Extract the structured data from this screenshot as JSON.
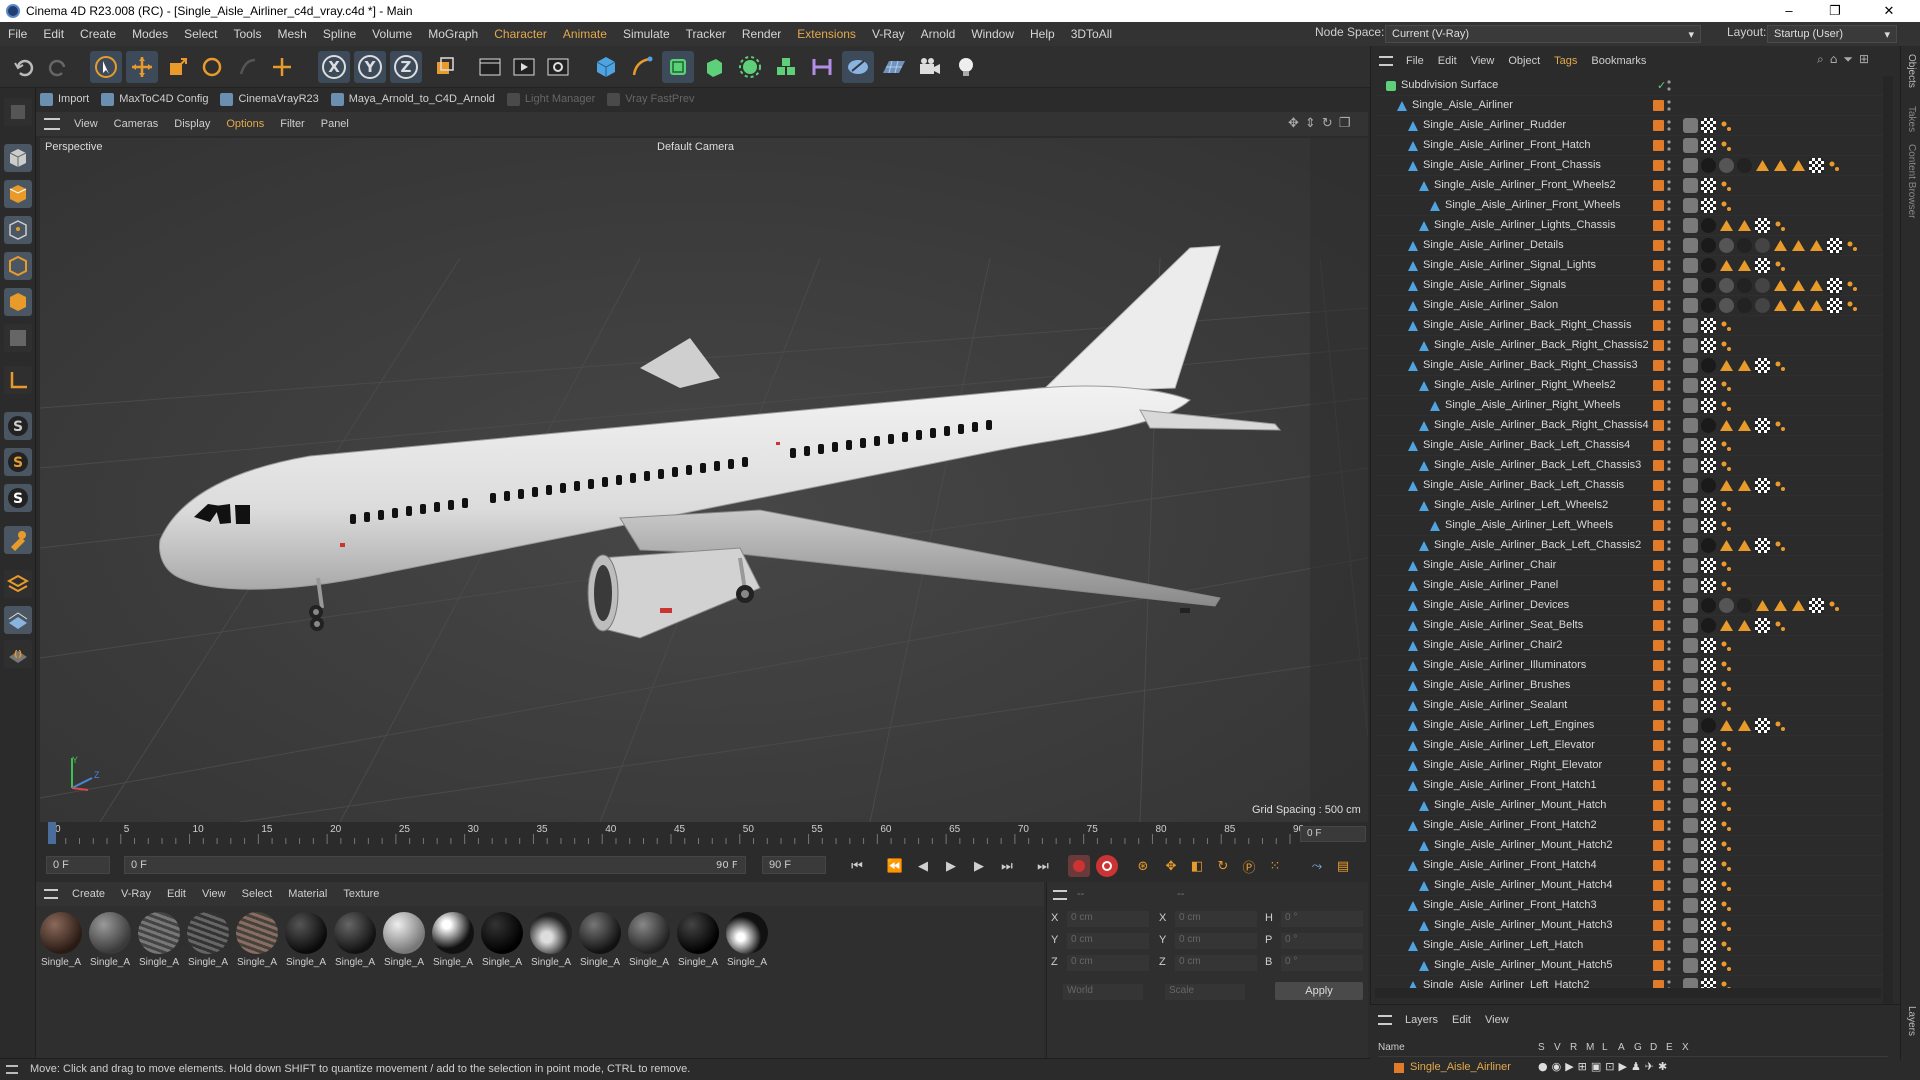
{
  "window": {
    "title": "Cinema 4D R23.008 (RC) - [Single_Aisle_Airliner_c4d_vray.c4d *] - Main",
    "controls": [
      "–",
      "❐",
      "✕"
    ]
  },
  "menubar": [
    "File",
    "Edit",
    "Create",
    "Modes",
    "Select",
    "Tools",
    "Mesh",
    "Spline",
    "Volume",
    "MoGraph",
    "Character",
    "Animate",
    "Simulate",
    "Tracker",
    "Render",
    "Extensions",
    "V-Ray",
    "Arnold",
    "Window",
    "Help",
    "3DToAll"
  ],
  "menubar_highlighted": [
    "Character",
    "Animate",
    "Extensions"
  ],
  "node_space": {
    "label": "Node Space:",
    "value": "Current (V-Ray)"
  },
  "layout": {
    "label": "Layout:",
    "value": "Startup (User)"
  },
  "plugins": [
    {
      "label": "Import",
      "dim": false
    },
    {
      "label": "MaxToC4D Config",
      "dim": false
    },
    {
      "label": "CinemaVrayR23",
      "dim": false
    },
    {
      "label": "Maya_Arnold_to_C4D_Arnold",
      "dim": false
    },
    {
      "label": "Light Manager",
      "dim": true
    },
    {
      "label": "Vray FastPrev",
      "dim": true
    }
  ],
  "viewport_menu": [
    "View",
    "Cameras",
    "Display",
    "Options",
    "Filter",
    "Panel"
  ],
  "viewport_menu_highlight": "Options",
  "viewport": {
    "mode": "Perspective",
    "camera": "Default Camera",
    "grid_spacing": "Grid Spacing : 500 cm",
    "axis_y": "Y",
    "axis_z": "Z"
  },
  "timeline": {
    "ticks": [
      "0",
      "5",
      "10",
      "15",
      "20",
      "25",
      "30",
      "35",
      "40",
      "45",
      "50",
      "55",
      "60",
      "65",
      "70",
      "75",
      "80",
      "85",
      "90"
    ],
    "frame_end_field": "0 F"
  },
  "time_controls": {
    "start": "0 F",
    "current": "0 F",
    "range_end": "90 F",
    "end": "90 F"
  },
  "material_menu": [
    "Create",
    "V-Ray",
    "Edit",
    "View",
    "Select",
    "Material",
    "Texture"
  ],
  "materials": [
    "Single_A",
    "Single_A",
    "Single_A",
    "Single_A",
    "Single_A",
    "Single_A",
    "Single_A",
    "Single_A",
    "Single_A",
    "Single_A",
    "Single_A",
    "Single_A",
    "Single_A",
    "Single_A",
    "Single_A"
  ],
  "coordinates": {
    "header": "--",
    "header2": "--",
    "rows": [
      {
        "l1": "X",
        "v1": "0 cm",
        "l2": "X",
        "v2": "0 cm",
        "l3": "H",
        "v3": "0 °"
      },
      {
        "l1": "Y",
        "v1": "0 cm",
        "l2": "Y",
        "v2": "0 cm",
        "l3": "P",
        "v3": "0 °"
      },
      {
        "l1": "Z",
        "v1": "0 cm",
        "l2": "Z",
        "v2": "0 cm",
        "l3": "B",
        "v3": "0 °"
      }
    ],
    "world": "World",
    "scale": "Scale",
    "apply": "Apply"
  },
  "status": "Move: Click and drag to move elements. Hold down SHIFT to quantize movement / add to the selection in point mode, CTRL to remove.",
  "object_menu": [
    "File",
    "Edit",
    "View",
    "Object",
    "Tags",
    "Bookmarks"
  ],
  "object_menu_highlight": "Tags",
  "objects": [
    {
      "name": "Subdivision Surface",
      "indent": 0,
      "tags": 0
    },
    {
      "name": "Single_Aisle_Airliner",
      "indent": 1,
      "tags": 0
    },
    {
      "name": "Single_Aisle_Airliner_Rudder",
      "indent": 2,
      "tags": 3
    },
    {
      "name": "Single_Aisle_Airliner_Front_Hatch",
      "indent": 2,
      "tags": 3
    },
    {
      "name": "Single_Aisle_Airliner_Front_Chassis",
      "indent": 2,
      "tags": 9
    },
    {
      "name": "Single_Aisle_Airliner_Front_Wheels2",
      "indent": 3,
      "tags": 3
    },
    {
      "name": "Single_Aisle_Airliner_Front_Wheels",
      "indent": 4,
      "tags": 3
    },
    {
      "name": "Single_Aisle_Airliner_Lights_Chassis",
      "indent": 3,
      "tags": 6
    },
    {
      "name": "Single_Aisle_Airliner_Details",
      "indent": 2,
      "tags": 10
    },
    {
      "name": "Single_Aisle_Airliner_Signal_Lights",
      "indent": 2,
      "tags": 6
    },
    {
      "name": "Single_Aisle_Airliner_Signals",
      "indent": 2,
      "tags": 10
    },
    {
      "name": "Single_Aisle_Airliner_Salon",
      "indent": 2,
      "tags": 10
    },
    {
      "name": "Single_Aisle_Airliner_Back_Right_Chassis",
      "indent": 2,
      "tags": 3
    },
    {
      "name": "Single_Aisle_Airliner_Back_Right_Chassis2",
      "indent": 3,
      "tags": 3
    },
    {
      "name": "Single_Aisle_Airliner_Back_Right_Chassis3",
      "indent": 2,
      "tags": 6
    },
    {
      "name": "Single_Aisle_Airliner_Right_Wheels2",
      "indent": 3,
      "tags": 3
    },
    {
      "name": "Single_Aisle_Airliner_Right_Wheels",
      "indent": 4,
      "tags": 3
    },
    {
      "name": "Single_Aisle_Airliner_Back_Right_Chassis4",
      "indent": 3,
      "tags": 6
    },
    {
      "name": "Single_Aisle_Airliner_Back_Left_Chassis4",
      "indent": 2,
      "tags": 3
    },
    {
      "name": "Single_Aisle_Airliner_Back_Left_Chassis3",
      "indent": 3,
      "tags": 3
    },
    {
      "name": "Single_Aisle_Airliner_Back_Left_Chassis",
      "indent": 2,
      "tags": 6
    },
    {
      "name": "Single_Aisle_Airliner_Left_Wheels2",
      "indent": 3,
      "tags": 3
    },
    {
      "name": "Single_Aisle_Airliner_Left_Wheels",
      "indent": 4,
      "tags": 3
    },
    {
      "name": "Single_Aisle_Airliner_Back_Left_Chassis2",
      "indent": 3,
      "tags": 6
    },
    {
      "name": "Single_Aisle_Airliner_Chair",
      "indent": 2,
      "tags": 3
    },
    {
      "name": "Single_Aisle_Airliner_Panel",
      "indent": 2,
      "tags": 3
    },
    {
      "name": "Single_Aisle_Airliner_Devices",
      "indent": 2,
      "tags": 9
    },
    {
      "name": "Single_Aisle_Airliner_Seat_Belts",
      "indent": 2,
      "tags": 6
    },
    {
      "name": "Single_Aisle_Airliner_Chair2",
      "indent": 2,
      "tags": 3
    },
    {
      "name": "Single_Aisle_Airliner_Illuminators",
      "indent": 2,
      "tags": 3
    },
    {
      "name": "Single_Aisle_Airliner_Brushes",
      "indent": 2,
      "tags": 3
    },
    {
      "name": "Single_Aisle_Airliner_Sealant",
      "indent": 2,
      "tags": 3
    },
    {
      "name": "Single_Aisle_Airliner_Left_Engines",
      "indent": 2,
      "tags": 6
    },
    {
      "name": "Single_Aisle_Airliner_Left_Elevator",
      "indent": 2,
      "tags": 3
    },
    {
      "name": "Single_Aisle_Airliner_Right_Elevator",
      "indent": 2,
      "tags": 3
    },
    {
      "name": "Single_Aisle_Airliner_Front_Hatch1",
      "indent": 2,
      "tags": 3
    },
    {
      "name": "Single_Aisle_Airliner_Mount_Hatch",
      "indent": 3,
      "tags": 3
    },
    {
      "name": "Single_Aisle_Airliner_Front_Hatch2",
      "indent": 2,
      "tags": 3
    },
    {
      "name": "Single_Aisle_Airliner_Mount_Hatch2",
      "indent": 3,
      "tags": 3
    },
    {
      "name": "Single_Aisle_Airliner_Front_Hatch4",
      "indent": 2,
      "tags": 3
    },
    {
      "name": "Single_Aisle_Airliner_Mount_Hatch4",
      "indent": 3,
      "tags": 3
    },
    {
      "name": "Single_Aisle_Airliner_Front_Hatch3",
      "indent": 2,
      "tags": 3
    },
    {
      "name": "Single_Aisle_Airliner_Mount_Hatch3",
      "indent": 3,
      "tags": 3
    },
    {
      "name": "Single_Aisle_Airliner_Left_Hatch",
      "indent": 2,
      "tags": 3
    },
    {
      "name": "Single_Aisle_Airliner_Mount_Hatch5",
      "indent": 3,
      "tags": 3
    },
    {
      "name": "Single_Aisle_Airliner_Left_Hatch2",
      "indent": 2,
      "tags": 3
    }
  ],
  "right_tabs": [
    "Objects",
    "Takes",
    "Content Browser"
  ],
  "layers_tab": "Layers",
  "layers_menu": [
    "Layers",
    "Edit",
    "View"
  ],
  "layers_header": {
    "name": "Name",
    "cols": [
      "S",
      "V",
      "R",
      "M",
      "L",
      "A",
      "G",
      "D",
      "E",
      "X"
    ]
  },
  "layer_row": "Single_Aisle_Airliner",
  "colors": {
    "accent": "#e3a94c",
    "orange_tag": "#e07b2a",
    "selection_blue": "#3c4a5a"
  }
}
